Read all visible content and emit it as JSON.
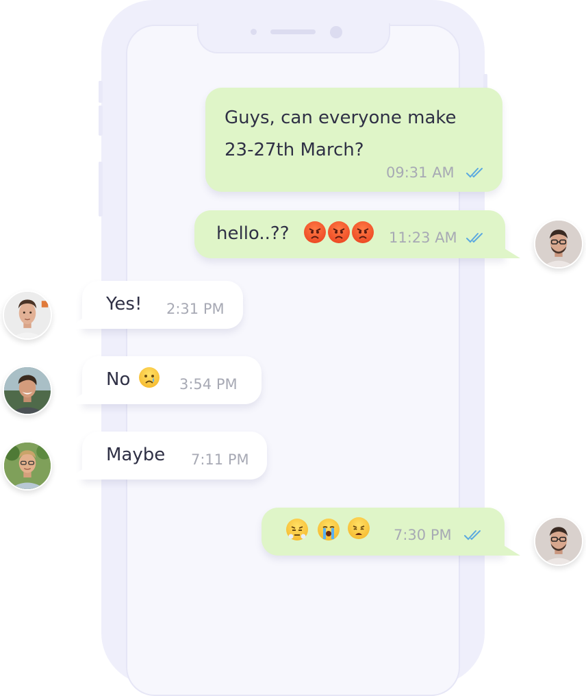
{
  "theme": {
    "outgoing_bubble": "#dff5c8",
    "incoming_bubble": "#ffffff",
    "tick_color": "#5aa8e0",
    "phone_frame": "#efeffb"
  },
  "messages": [
    {
      "direction": "outgoing",
      "text_line1": "Guys, can everyone make",
      "text_line2": "23-27th March?",
      "time": "09:31 AM",
      "status": "read"
    },
    {
      "direction": "outgoing",
      "text": "hello..??",
      "emojis": [
        "angry-face-emoji",
        "angry-face-emoji",
        "angry-face-emoji"
      ],
      "time": "11:23 AM",
      "status": "read",
      "avatar": "avatar-man-glasses"
    },
    {
      "direction": "incoming",
      "text": "Yes!",
      "time": "2:31 PM",
      "avatar": "avatar-man-short-hair"
    },
    {
      "direction": "incoming",
      "text": "No",
      "emojis": [
        "crying-face-emoji"
      ],
      "time": "3:54 PM",
      "avatar": "avatar-smiling-man"
    },
    {
      "direction": "incoming",
      "text": "Maybe",
      "time": "7:11 PM",
      "avatar": "avatar-man-outdoors"
    },
    {
      "direction": "outgoing",
      "emojis": [
        "steam-from-nose-emoji",
        "loudly-crying-face-emoji",
        "weary-face-emoji"
      ],
      "time": "7:30 PM",
      "status": "read",
      "avatar": "avatar-man-glasses"
    }
  ]
}
